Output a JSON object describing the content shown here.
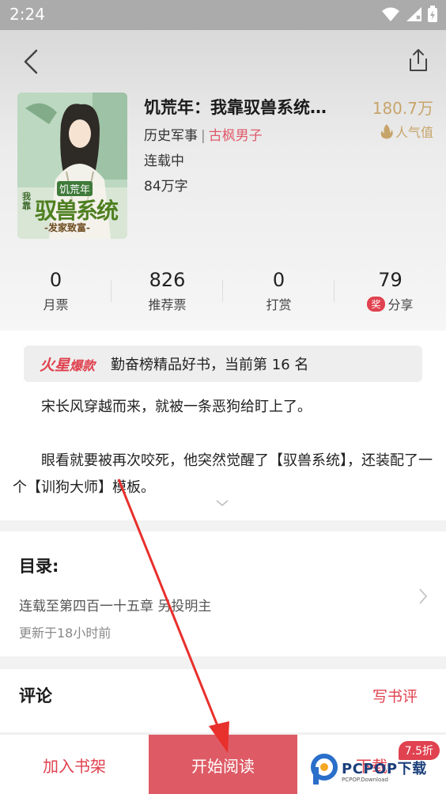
{
  "status_bar": {
    "time": "2:24"
  },
  "book": {
    "title": "饥荒年：我靠驭兽系统…",
    "genre": "历史军事",
    "sub_genre": "古枫男子",
    "status": "连载中",
    "word_count": "84万字",
    "popularity_value": "180.7万",
    "popularity_label": "人气值",
    "cover_title_top": "饥荒年",
    "cover_title_main": "驭兽系统",
    "cover_title_side": "我靠",
    "cover_subtitle": "-发家致富-"
  },
  "stats": [
    {
      "value": "0",
      "label": "月票"
    },
    {
      "value": "826",
      "label": "推荐票"
    },
    {
      "value": "0",
      "label": "打赏"
    },
    {
      "value": "79",
      "label": "分享",
      "badge": "奖"
    }
  ],
  "rank": {
    "logo_main": "火星",
    "logo_sub": "爆款",
    "text": "勤奋榜精品好书，当前第 16 名"
  },
  "synopsis": [
    "宋长风穿越而来，就被一条恶狗给盯上了。",
    "眼看就要被再次咬死，他突然觉醒了【驭兽系统】，还装配了一个【训狗大师】模板。"
  ],
  "toc": {
    "title": "目录:",
    "latest": "连载至第四百一十五章 另投明主",
    "updated": "更新于18小时前"
  },
  "comments": {
    "title": "评论",
    "write_label": "写书评"
  },
  "bottom_bar": {
    "add_shelf": "加入书架",
    "start_reading": "开始阅读",
    "download": "下载",
    "discount": "7.5折"
  },
  "watermark": {
    "brand": "PCPOP下载",
    "sub": "PCPOP.Download"
  },
  "colors": {
    "accent": "#e0424f",
    "read_button": "#de5b66",
    "popularity": "#c7a46a"
  }
}
